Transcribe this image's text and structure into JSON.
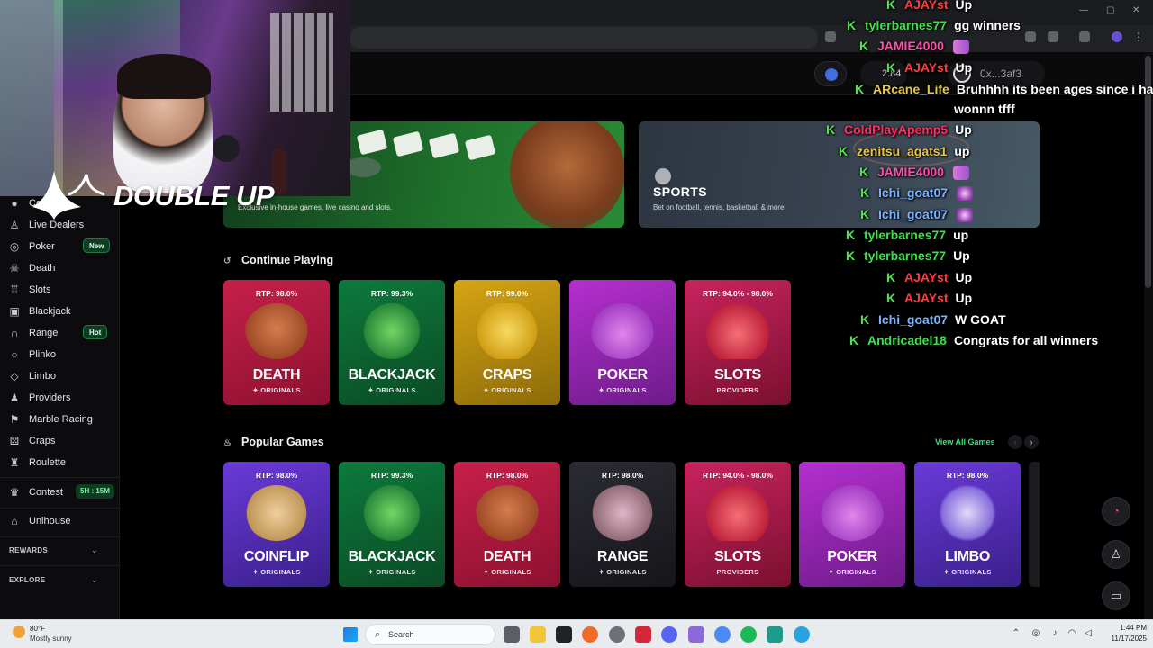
{
  "header": {
    "balance": "2.84",
    "wallet": "0x...3af3"
  },
  "sidebar": {
    "items": [
      {
        "label": "Coinflip",
        "icon": "coin-icon"
      },
      {
        "label": "Live Dealers",
        "icon": "person-icon"
      },
      {
        "label": "Poker",
        "icon": "poker-chip-icon",
        "badge": "New"
      },
      {
        "label": "Death",
        "icon": "skull-icon"
      },
      {
        "label": "Slots",
        "icon": "slots-icon"
      },
      {
        "label": "Blackjack",
        "icon": "cards-icon"
      },
      {
        "label": "Range",
        "icon": "horseshoe-icon",
        "badge": "Hot"
      },
      {
        "label": "Plinko",
        "icon": "plinko-icon"
      },
      {
        "label": "Limbo",
        "icon": "limbo-icon"
      },
      {
        "label": "Providers",
        "icon": "providers-icon"
      },
      {
        "label": "Marble Racing",
        "icon": "flag-icon"
      },
      {
        "label": "Craps",
        "icon": "dice-icon"
      },
      {
        "label": "Roulette",
        "icon": "roulette-icon"
      }
    ],
    "contest": {
      "label": "Contest",
      "timer": "5H : 15M"
    },
    "unihouse": "Unihouse",
    "rewards": "REWARDS",
    "explore": "EXPLORE"
  },
  "banners": {
    "casino_desc": "Exclusive in-house games, live casino and slots.",
    "sports_title": "SPORTS",
    "sports_desc": "Bet on football, tennis, basketball & more"
  },
  "continue_playing": {
    "title": "Continue Playing",
    "cards": [
      {
        "rtp": "RTP: 98.0%",
        "name": "DEATH",
        "sub": "✦ ORIGINALS"
      },
      {
        "rtp": "RTP: 99.3%",
        "name": "BLACKJACK",
        "sub": "✦ ORIGINALS"
      },
      {
        "rtp": "RTP: 99.0%",
        "name": "CRAPS",
        "sub": "✦ ORIGINALS"
      },
      {
        "rtp": "",
        "name": "POKER",
        "sub": "✦ ORIGINALS"
      },
      {
        "rtp": "RTP: 94.0% - 98.0%",
        "name": "SLOTS",
        "sub": "PROVIDERS"
      }
    ]
  },
  "popular_games": {
    "title": "Popular Games",
    "view_all": "View All Games",
    "cards": [
      {
        "rtp": "RTP: 98.0%",
        "name": "COINFLIP",
        "sub": "✦ ORIGINALS"
      },
      {
        "rtp": "RTP: 99.3%",
        "name": "BLACKJACK",
        "sub": "✦ ORIGINALS"
      },
      {
        "rtp": "RTP: 98.0%",
        "name": "DEATH",
        "sub": "✦ ORIGINALS"
      },
      {
        "rtp": "RTP: 98.0%",
        "name": "RANGE",
        "sub": "✦ ORIGINALS"
      },
      {
        "rtp": "RTP: 94.0% - 98.0%",
        "name": "SLOTS",
        "sub": "PROVIDERS"
      },
      {
        "rtp": "",
        "name": "POKER",
        "sub": "✦ ORIGINALS"
      },
      {
        "rtp": "RTP: 98.0%",
        "name": "LIMBO",
        "sub": "✦ ORIGINALS"
      }
    ]
  },
  "overlay": {
    "logo_text": "DOUBLE UP"
  },
  "chat": [
    {
      "user": "AJAYst",
      "color": "#ff3b3b",
      "msg": "Up"
    },
    {
      "user": "tylerbarnes77",
      "color": "#3fe04a",
      "msg": "gg winners"
    },
    {
      "user": "JAMIE4000",
      "color": "#ff4fa8",
      "msg": ""
    },
    {
      "user": "AJAYst",
      "color": "#ff3b3b",
      "msg": "Up"
    },
    {
      "user": "ARcane_Life",
      "color": "#e8c64a",
      "msg": "Bruhhhh its been ages since i have"
    },
    {
      "user": "",
      "color": "#ffffff",
      "msg": "wonnn tfff"
    },
    {
      "user": "ColdPlayApemp5",
      "color": "#ff2e63",
      "msg": "Up"
    },
    {
      "user": "zenitsu_agats1",
      "color": "#e8c64a",
      "msg": "up"
    },
    {
      "user": "JAMIE4000",
      "color": "#ff4fa8",
      "msg": ""
    },
    {
      "user": "Ichi_goat07",
      "color": "#7ab3ff",
      "msg": ""
    },
    {
      "user": "Ichi_goat07",
      "color": "#7ab3ff",
      "msg": ""
    },
    {
      "user": "tylerbarnes77",
      "color": "#3fe04a",
      "msg": "up"
    },
    {
      "user": "tylerbarnes77",
      "color": "#3fe04a",
      "msg": "Up"
    },
    {
      "user": "AJAYst",
      "color": "#ff3b3b",
      "msg": "Up"
    },
    {
      "user": "AJAYst",
      "color": "#ff3b3b",
      "msg": "Up"
    },
    {
      "user": "Ichi_goat07",
      "color": "#7ab3ff",
      "msg": "W GOAT"
    },
    {
      "user": "Andricadel18",
      "color": "#3fe04a",
      "msg": "Congrats for all winners"
    }
  ],
  "taskbar": {
    "temp": "80°F",
    "condition": "Mostly sunny",
    "search": "Search",
    "time": "1:44 PM",
    "date": "11/17/2025"
  },
  "colors": {
    "accent_green": "#37e07a",
    "background": "#000000",
    "sidebar": "#0c0c0e"
  }
}
